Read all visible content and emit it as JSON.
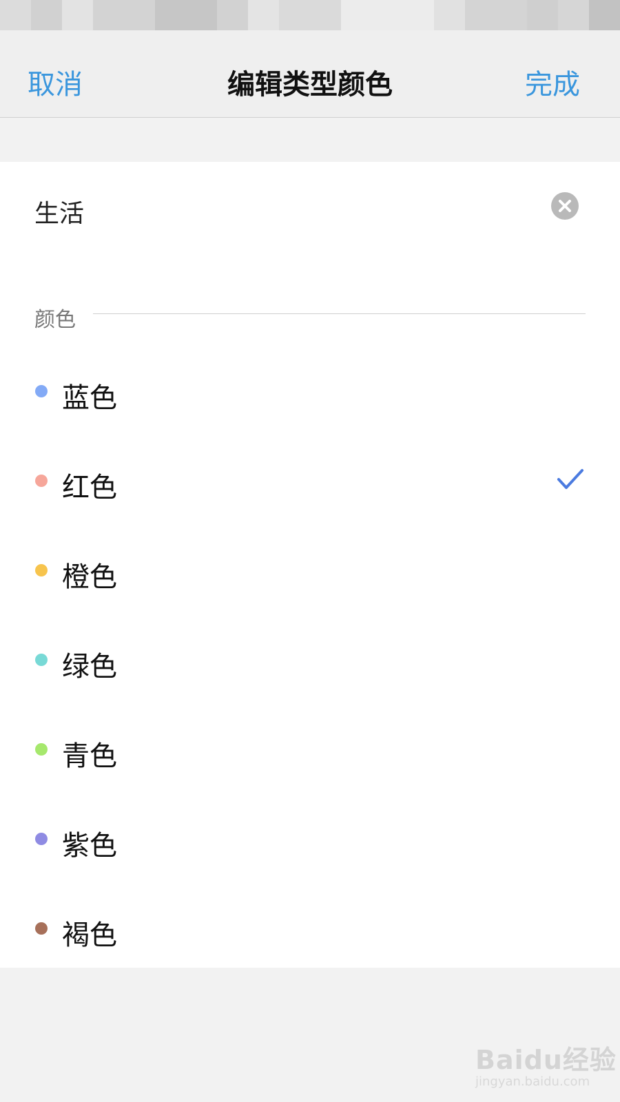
{
  "navbar": {
    "cancel_label": "取消",
    "title": "编辑类型颜色",
    "done_label": "完成",
    "accent_color": "#3a96dd"
  },
  "type_name": {
    "value": "生活",
    "clear_icon": "clear-circle-icon"
  },
  "color_section": {
    "label": "颜色"
  },
  "colors": [
    {
      "label": "蓝色",
      "swatch": "#83aaf6",
      "selected": false
    },
    {
      "label": "红色",
      "swatch": "#f6a69a",
      "selected": true
    },
    {
      "label": "橙色",
      "swatch": "#f7c44d",
      "selected": false
    },
    {
      "label": "绿色",
      "swatch": "#78d9d6",
      "selected": false
    },
    {
      "label": "青色",
      "swatch": "#a6e86d",
      "selected": false
    },
    {
      "label": "紫色",
      "swatch": "#8f8be3",
      "selected": false
    },
    {
      "label": "褐色",
      "swatch": "#a7705a",
      "selected": false
    }
  ],
  "selected_check_color": "#4b7be0",
  "watermark": {
    "logo": "Baidu经验",
    "url": "jingyan.baidu.com"
  }
}
